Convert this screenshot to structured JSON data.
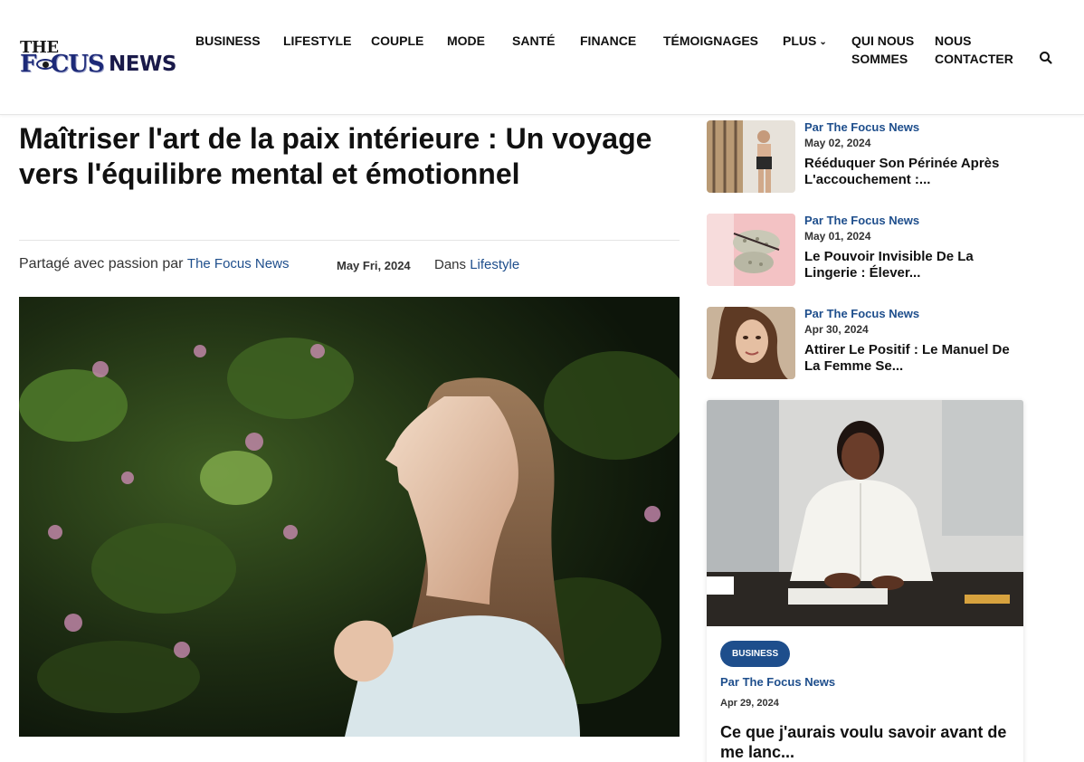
{
  "header": {
    "logo": {
      "the": "THE",
      "focus": "F●CUS",
      "news": "NEWS"
    },
    "nav": [
      {
        "label": "BUSINESS"
      },
      {
        "label": "LIFESTYLE"
      },
      {
        "label": "COUPLE"
      },
      {
        "label": "MODE"
      },
      {
        "label": "SANTÉ"
      },
      {
        "label": "FINANCE"
      },
      {
        "label": "TÉMOIGNAGES"
      },
      {
        "label": "PLUS"
      },
      {
        "label": "QUI NOUS SOMMES"
      },
      {
        "label": "NOUS CONTACTER"
      }
    ],
    "search_icon": "search-icon"
  },
  "article": {
    "title": "Maîtriser l'art de la paix intérieure : Un voyage vers l'équilibre mental et émotionnel",
    "byline_prefix": "Partagé avec passion par",
    "author": "The Focus News",
    "date": "May Fri, 2024",
    "category_prefix": "Dans",
    "category": "Lifestyle"
  },
  "sidebar": {
    "items": [
      {
        "author": "Par The Focus News",
        "date": "May 02, 2024",
        "title": "Rééduquer Son Périnée Après L'accouchement :..."
      },
      {
        "author": "Par The Focus News",
        "date": "May 01, 2024",
        "title": "Le Pouvoir Invisible De La Lingerie : Élever..."
      },
      {
        "author": "Par The Focus News",
        "date": "Apr 30, 2024",
        "title": "Attirer Le Positif : Le Manuel De La Femme Se..."
      }
    ],
    "card": {
      "badge": "BUSINESS",
      "author": "Par The Focus News",
      "date": "Apr 29, 2024",
      "title": "Ce que j'aurais voulu savoir avant de me lanc..."
    }
  },
  "colors": {
    "accent": "#1e4e8c",
    "text": "#111111",
    "border": "#e5e5e5"
  }
}
